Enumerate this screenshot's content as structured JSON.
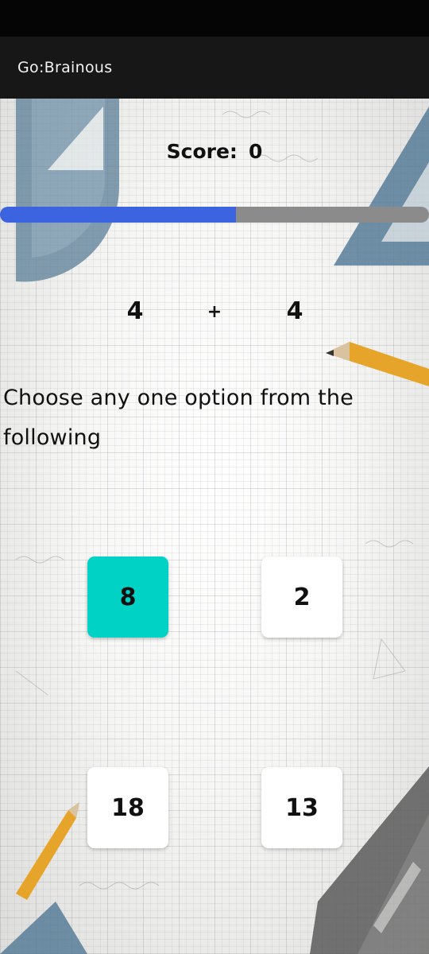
{
  "app": {
    "title": "Go:Brainous"
  },
  "score": {
    "label": "Score:",
    "value": "0"
  },
  "progress": {
    "fraction": 0.55,
    "fill_color": "#3c63e0",
    "track_color": "#8b8b8b"
  },
  "equation": {
    "left_operand": "4",
    "operator": "+",
    "right_operand": "4"
  },
  "question": {
    "text": "Choose any one option from the following"
  },
  "options": [
    {
      "label": "8",
      "selected": true
    },
    {
      "label": "2",
      "selected": false
    },
    {
      "label": "18",
      "selected": false
    },
    {
      "label": "13",
      "selected": false
    }
  ],
  "colors": {
    "selected_option": "#00d3c6",
    "option_background": "#ffffff",
    "app_bar": "#171717",
    "status_bar": "#050505"
  }
}
